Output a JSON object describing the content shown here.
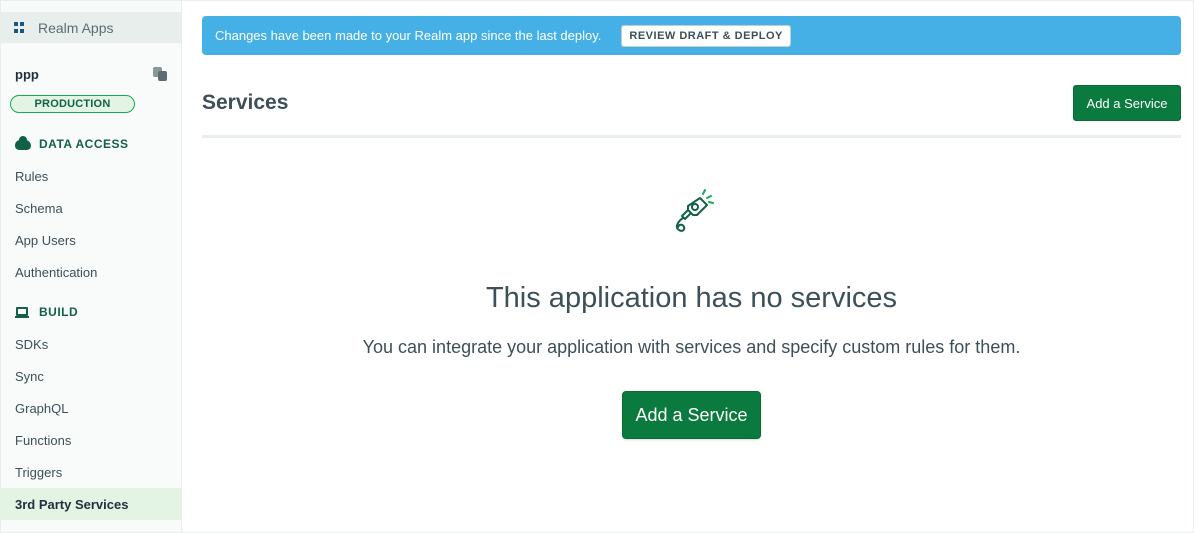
{
  "sidebar": {
    "back_link": "Realm Apps",
    "app_name": "ppp",
    "environment_badge": "PRODUCTION",
    "sections": [
      {
        "title": "DATA ACCESS",
        "icon": "cloud-icon",
        "items": [
          "Rules",
          "Schema",
          "App Users",
          "Authentication"
        ]
      },
      {
        "title": "BUILD",
        "icon": "build-icon",
        "items": [
          "SDKs",
          "Sync",
          "GraphQL",
          "Functions",
          "Triggers",
          "3rd Party Services"
        ]
      }
    ],
    "active_item": "3rd Party Services"
  },
  "banner": {
    "message": "Changes have been made to your Realm app since the last deploy.",
    "button_label": "REVIEW DRAFT & DEPLOY"
  },
  "header": {
    "title": "Services",
    "add_button_label": "Add a Service"
  },
  "empty_state": {
    "icon": "plug-icon",
    "title": "This application has no services",
    "subtitle": "You can integrate your application with services and specify custom rules for them.",
    "button_label": "Add a Service"
  },
  "colors": {
    "accent_green": "#0b7a3e",
    "banner_blue": "#45b0e6",
    "badge_green": "#13aa52",
    "active_nav_bg": "#e4f4e4"
  }
}
